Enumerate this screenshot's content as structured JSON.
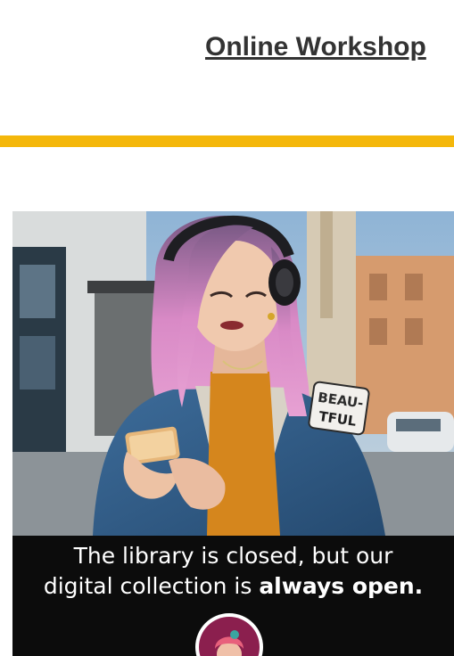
{
  "header": {
    "link_text": "Online Workshop"
  },
  "promo": {
    "caption_line1": "The library is closed, but our",
    "caption_line2_prefix": "digital collection is ",
    "caption_line2_bold": "always open.",
    "patch_line1": "BEAU-",
    "patch_line2": "TFUL"
  },
  "colors": {
    "accent_bar": "#f4b70b",
    "heading_text": "#333333",
    "caption_background": "#0c0c0c",
    "logo_accent": "#8b1f4e"
  },
  "icons": {
    "app_logo": "libby-app-logo-icon"
  }
}
